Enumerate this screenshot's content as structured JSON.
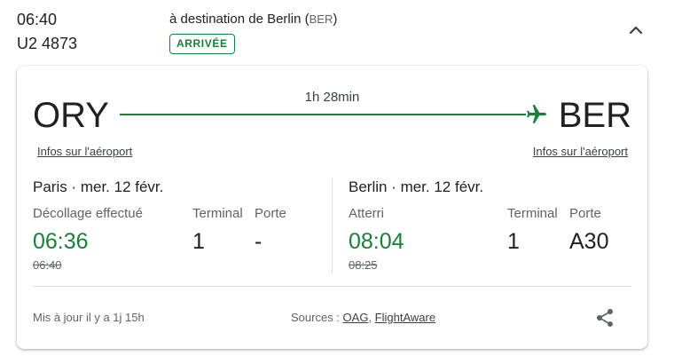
{
  "flight": {
    "scheduled_time": "06:40",
    "number": "U2 4873",
    "destination_prefix": "à destination de Berlin (",
    "destination_code": "BER",
    "destination_suffix": ")",
    "status": "ARRIVÉE",
    "status_color": "#188038"
  },
  "route": {
    "origin_code": "ORY",
    "destination_code": "BER",
    "duration": "1h 28min",
    "origin_link": "Infos sur l'aéroport",
    "destination_link": "Infos sur l'aéroport"
  },
  "departure": {
    "city_date": "Paris · mer. 12 févr.",
    "time_label": "Décollage effectué",
    "actual_time": "06:36",
    "scheduled_time": "06:40",
    "terminal_label": "Terminal",
    "terminal": "1",
    "gate_label": "Porte",
    "gate": "-"
  },
  "arrival": {
    "city_date": "Berlin · mer. 12 févr.",
    "time_label": "Atterri",
    "actual_time": "08:04",
    "scheduled_time": "08:25",
    "terminal_label": "Terminal",
    "terminal": "1",
    "gate_label": "Porte",
    "gate": "A30"
  },
  "footer": {
    "updated": "Mis à jour il y a 1j 15h",
    "sources_label": "Sources : ",
    "source_1": "OAG",
    "separator": ", ",
    "source_2": "FlightAware"
  },
  "icons": {
    "collapse": "chevron-up-icon",
    "plane": "airplane-icon",
    "share": "share-icon"
  },
  "colors": {
    "accent_green": "#188038",
    "text_primary": "#202124",
    "text_secondary": "#5f6368",
    "divider": "#dadce0"
  }
}
